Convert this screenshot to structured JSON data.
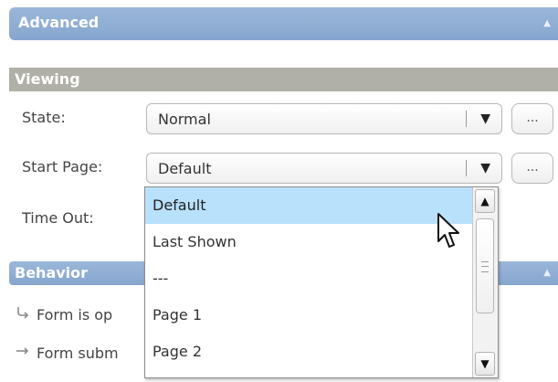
{
  "panel": {
    "title": "Advanced",
    "collapse_glyph": "▲"
  },
  "sections": {
    "viewing": {
      "title": "Viewing",
      "state": {
        "label": "State:",
        "value": "Normal",
        "arrow": "▼",
        "ellipsis": "..."
      },
      "start_page": {
        "label": "Start Page:",
        "value": "Default",
        "arrow": "▼",
        "ellipsis": "..."
      },
      "time_out": {
        "label": "Time Out:"
      }
    },
    "behavior": {
      "title": "Behavior",
      "collapse_glyph": "▲",
      "items": [
        {
          "icon": "form-open-icon",
          "text": "Form is op"
        },
        {
          "icon": "arrow-right-icon",
          "text": "Form subm"
        }
      ]
    }
  },
  "dropdown": {
    "options": [
      "Default",
      "Last Shown",
      "---",
      "Page 1",
      "Page 2"
    ],
    "selected_index": 0,
    "scroll": {
      "up": "▲",
      "down": "▼"
    }
  },
  "colors": {
    "header_blue": "#8fb0d8",
    "section_gray": "#b0b0a8",
    "selected_row": "#b9e1fb"
  }
}
